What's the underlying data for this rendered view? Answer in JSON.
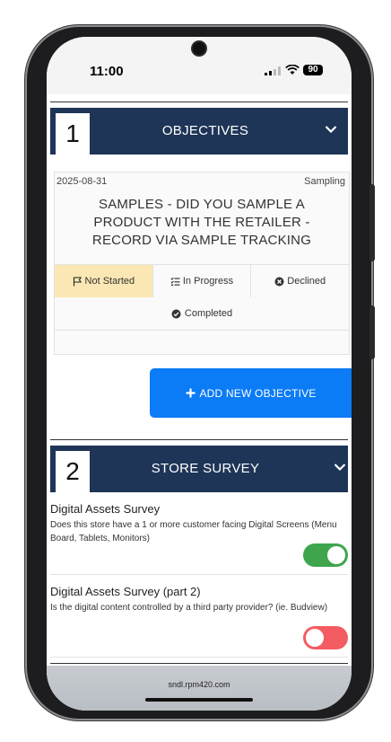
{
  "status_bar": {
    "time": "11:00",
    "battery": "90"
  },
  "sections": {
    "objectives": {
      "number": "1",
      "title": "OBJECTIVES",
      "card": {
        "date": "2025-08-31",
        "type": "Sampling",
        "title": "SAMPLES - DID YOU SAMPLE A PRODUCT WITH THE RETAILER - RECORD VIA SAMPLE TRACKING",
        "statuses": {
          "not_started": "Not Started",
          "in_progress": "In Progress",
          "declined": "Declined",
          "completed": "Completed"
        },
        "active_status": "Not Started"
      },
      "add_button": "ADD NEW OBJECTIVE"
    },
    "store_survey": {
      "number": "2",
      "title": "STORE SURVEY",
      "items": [
        {
          "title": "Digital Assets Survey",
          "question": "Does this store have a 1 or more customer facing Digital Screens (Menu Board, Tablets, Monitors)",
          "answer": true
        },
        {
          "title": "Digital Assets Survey (part 2)",
          "question": "Is the digital content controlled by a third party provider? (ie. Budview)",
          "answer": false
        }
      ]
    }
  },
  "browser": {
    "url": "sndl.rpm420.com"
  },
  "colors": {
    "header_navy": "#1e3557",
    "primary_blue": "#0b7bf6",
    "active_status": "#fbe7b3",
    "toggle_on": "#3ea54d",
    "toggle_off": "#f25c62"
  }
}
